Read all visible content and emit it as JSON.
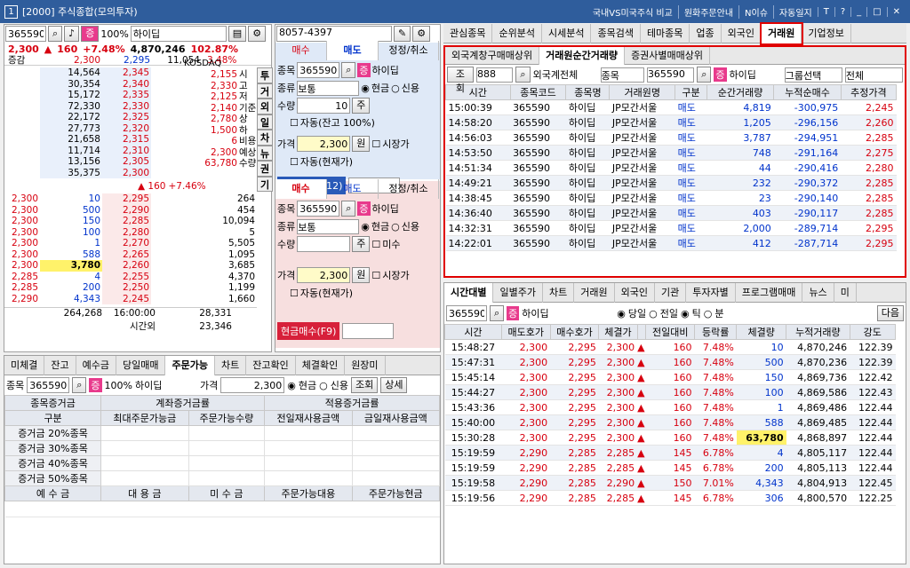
{
  "window": {
    "number": "1",
    "title": "[2000] 주식종합(모의투자)",
    "menu": [
      "국내VS미국주식 비교",
      "원화주문안내",
      "N이슈",
      "자동일지",
      "T",
      "?"
    ]
  },
  "stock": {
    "code": "365590",
    "name": "하이딥",
    "ratio_badge": "증",
    "margin": "100%",
    "price": "2,300",
    "change": "160",
    "rate": "+7.48%",
    "volume": "4,870,246",
    "turnover": "102.87%",
    "label_change": "증감",
    "incr1": "2,300",
    "incr2": "2,295",
    "vol_small": "11,054",
    "small_rate": "3.48%",
    "market": "KOSDAQ"
  },
  "orderbook": {
    "asks": [
      {
        "qty": "14,564",
        "price": "2,345"
      },
      {
        "qty": "30,354",
        "price": "2,340"
      },
      {
        "qty": "15,172",
        "price": "2,335"
      },
      {
        "qty": "72,330",
        "price": "2,330"
      },
      {
        "qty": "22,172",
        "price": "2,325"
      },
      {
        "qty": "27,773",
        "price": "2,320"
      },
      {
        "qty": "21,658",
        "price": "2,315"
      },
      {
        "qty": "11,714",
        "price": "2,310"
      },
      {
        "qty": "13,156",
        "price": "2,305"
      },
      {
        "qty": "35,375",
        "price": "2,300"
      }
    ],
    "info": [
      {
        "v": "2,155",
        "k": "시"
      },
      {
        "v": "2,330",
        "k": "고"
      },
      {
        "v": "2,125",
        "k": "저"
      },
      {
        "v": "2,140",
        "k": "기준"
      },
      {
        "v": "2,780",
        "k": "상"
      },
      {
        "v": "1,500",
        "k": "하"
      },
      {
        "v": "6",
        "k": "비용"
      },
      {
        "v": "2,300",
        "k": "예상"
      },
      {
        "v": "63,780",
        "k": "수량"
      }
    ],
    "exp_change": "▲ 160",
    "exp_rate": "+7.46%",
    "bids": [
      {
        "ex": "2,300",
        "q1": "10",
        "price": "2,295",
        "qty": "264"
      },
      {
        "ex": "2,300",
        "q1": "500",
        "price": "2,290",
        "qty": "454"
      },
      {
        "ex": "2,300",
        "q1": "150",
        "price": "2,285",
        "qty": "10,094"
      },
      {
        "ex": "2,300",
        "q1": "100",
        "price": "2,280",
        "qty": "5"
      },
      {
        "ex": "2,300",
        "q1": "1",
        "price": "2,270",
        "qty": "5,505"
      },
      {
        "ex": "2,300",
        "q1": "588",
        "price": "2,265",
        "qty": "1,095"
      },
      {
        "ex": "2,300",
        "q1": "3,780",
        "price": "2,260",
        "qty": "3,685"
      },
      {
        "ex": "2,285",
        "q1": "4",
        "price": "2,255",
        "qty": "4,370"
      },
      {
        "ex": "2,285",
        "q1": "200",
        "price": "2,250",
        "qty": "1,199"
      },
      {
        "ex": "2,290",
        "q1": "4,343",
        "price": "2,245",
        "qty": "1,660"
      }
    ],
    "total_ask": "264,268",
    "time": "16:00:00",
    "total_bid": "28,331",
    "after_label": "시간외",
    "after_qty": "23,346"
  },
  "side_tabs": [
    "투",
    "거",
    "외",
    "일",
    "차",
    "뉴",
    "권",
    "기"
  ],
  "order_panel": {
    "account": "8057-4397",
    "tabs": [
      "매수",
      "매도",
      "정정/취소"
    ],
    "code_label": "종목",
    "type_label": "종류",
    "type_value": "보통",
    "cash": "현금",
    "credit": "신용",
    "qty_label": "수량",
    "qty": "10",
    "unit": "주",
    "auto": "자동(잔고 100%)",
    "price_label": "가격",
    "price": "2,300",
    "won": "원",
    "market_price": "시장가",
    "auto_price": "자동(현재가)",
    "sell_btn": "현금매도(F12)",
    "buy_btn": "현금매수(F9)",
    "check_short": "미수"
  },
  "bottom_left": {
    "tabs": [
      "미체결",
      "잔고",
      "예수금",
      "당일매매",
      "주문가능",
      "차트",
      "잔고확인",
      "체결확인",
      "원장미"
    ],
    "code": "365590",
    "price_label": "가격",
    "price": "2,300",
    "cash": "현금",
    "credit": "신용",
    "lookup": "조회",
    "detail": "상세",
    "hdr": [
      "종목증거금",
      "계좌증거금률",
      "적용증거금률"
    ],
    "cols": [
      "구분",
      "최대주문가능금",
      "주문가능수량",
      "전일재사용금액",
      "금일재사용금액"
    ],
    "rows": [
      "증거금 20%종목",
      "증거금 30%종목",
      "증거금 40%종목",
      "증거금 50%종목"
    ],
    "foot": [
      "예 수 금",
      "대 용 금",
      "미 수 금",
      "주문가능대용",
      "주문가능현금"
    ]
  },
  "right_tabs": [
    "관심종목",
    "순위분석",
    "시세분석",
    "종목검색",
    "테마종목",
    "업종",
    "외국인",
    "거래원",
    "기업정보"
  ],
  "broker": {
    "subtabs": [
      "외국계창구매매상위",
      "거래원순간거래량",
      "증권사별매매상위"
    ],
    "lookup": "조회",
    "broker_code": "888",
    "broker_name": "외국계전체",
    "stock_label": "종목",
    "code": "365590",
    "group": "그룹선택",
    "all": "전체",
    "cols": [
      "시간",
      "종목코드",
      "종목명",
      "거래원명",
      "구분",
      "순간거래량",
      "누적순매수",
      "추정가격"
    ],
    "rows": [
      [
        "15:00:39",
        "365590",
        "하이딥",
        "JP모간서울",
        "매도",
        "4,819",
        "-300,975",
        "2,245"
      ],
      [
        "14:58:20",
        "365590",
        "하이딥",
        "JP모간서울",
        "매도",
        "1,205",
        "-296,156",
        "2,260"
      ],
      [
        "14:56:03",
        "365590",
        "하이딥",
        "JP모간서울",
        "매도",
        "3,787",
        "-294,951",
        "2,285"
      ],
      [
        "14:53:50",
        "365590",
        "하이딥",
        "JP모간서울",
        "매도",
        "748",
        "-291,164",
        "2,275"
      ],
      [
        "14:51:34",
        "365590",
        "하이딥",
        "JP모간서울",
        "매도",
        "44",
        "-290,416",
        "2,280"
      ],
      [
        "14:49:21",
        "365590",
        "하이딥",
        "JP모간서울",
        "매도",
        "232",
        "-290,372",
        "2,285"
      ],
      [
        "14:38:45",
        "365590",
        "하이딥",
        "JP모간서울",
        "매도",
        "23",
        "-290,140",
        "2,285"
      ],
      [
        "14:36:40",
        "365590",
        "하이딥",
        "JP모간서울",
        "매도",
        "403",
        "-290,117",
        "2,285"
      ],
      [
        "14:32:31",
        "365590",
        "하이딥",
        "JP모간서울",
        "매도",
        "2,000",
        "-289,714",
        "2,295"
      ],
      [
        "14:22:01",
        "365590",
        "하이딥",
        "JP모간서울",
        "매도",
        "412",
        "-287,714",
        "2,295"
      ]
    ]
  },
  "ticks": {
    "tabs": [
      "시간대별",
      "일별주가",
      "차트",
      "거래원",
      "외국인",
      "기관",
      "투자자별",
      "프로그램매매",
      "뉴스",
      "미"
    ],
    "code": "365590",
    "today": "당일",
    "prev": "전일",
    "tick": "틱",
    "minute": "분",
    "next": "다음",
    "cols": [
      "시간",
      "매도호가",
      "매수호가",
      "체결가",
      "전일대비",
      "등락률",
      "체결량",
      "누적거래량",
      "강도"
    ],
    "rows": [
      [
        "15:48:27",
        "2,300",
        "2,295",
        "2,300",
        "160",
        "7.48%",
        "10",
        "4,870,246",
        "122.39"
      ],
      [
        "15:47:31",
        "2,300",
        "2,295",
        "2,300",
        "160",
        "7.48%",
        "500",
        "4,870,236",
        "122.39"
      ],
      [
        "15:45:14",
        "2,300",
        "2,295",
        "2,300",
        "160",
        "7.48%",
        "150",
        "4,869,736",
        "122.42"
      ],
      [
        "15:44:27",
        "2,300",
        "2,295",
        "2,300",
        "160",
        "7.48%",
        "100",
        "4,869,586",
        "122.43"
      ],
      [
        "15:43:36",
        "2,300",
        "2,295",
        "2,300",
        "160",
        "7.48%",
        "1",
        "4,869,486",
        "122.44"
      ],
      [
        "15:40:00",
        "2,300",
        "2,295",
        "2,300",
        "160",
        "7.48%",
        "588",
        "4,869,485",
        "122.44"
      ],
      [
        "15:30:28",
        "2,300",
        "2,295",
        "2,300",
        "160",
        "7.48%",
        "63,780",
        "4,868,897",
        "122.44"
      ],
      [
        "15:19:59",
        "2,290",
        "2,285",
        "2,285",
        "145",
        "6.78%",
        "4",
        "4,805,117",
        "122.44"
      ],
      [
        "15:19:59",
        "2,290",
        "2,285",
        "2,285",
        "145",
        "6.78%",
        "200",
        "4,805,113",
        "122.44"
      ],
      [
        "15:19:58",
        "2,290",
        "2,285",
        "2,290",
        "150",
        "7.01%",
        "4,343",
        "4,804,913",
        "122.45"
      ],
      [
        "15:19:56",
        "2,290",
        "2,285",
        "2,285",
        "145",
        "6.78%",
        "306",
        "4,800,570",
        "122.25"
      ]
    ]
  }
}
